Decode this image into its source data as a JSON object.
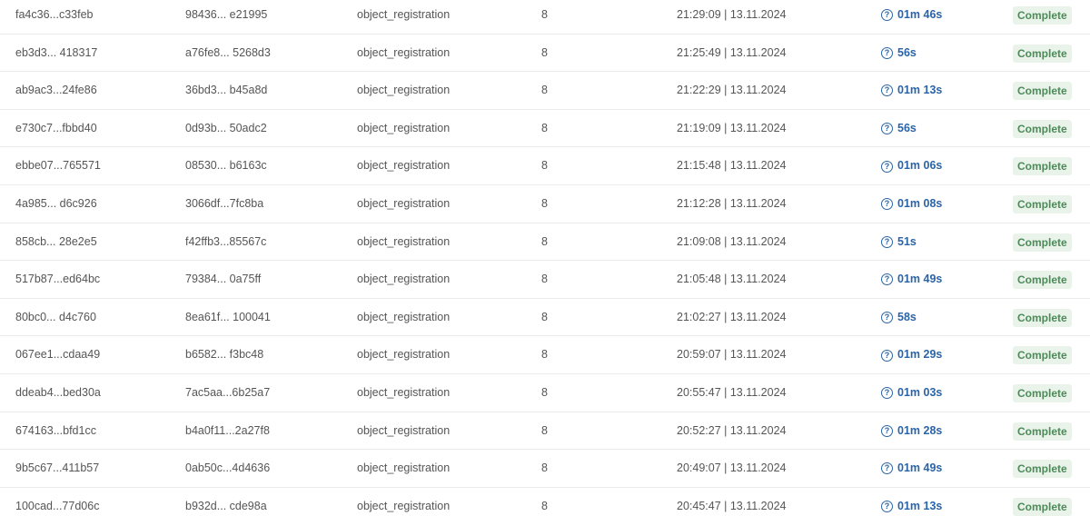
{
  "rows": [
    {
      "run_id": "fa4c36...c33feb",
      "hash": "98436... e21995",
      "task": "object_registration",
      "count": "8",
      "time": "21:29:09 | 13.11.2024",
      "duration": "01m 46s",
      "status": "Complete"
    },
    {
      "run_id": "eb3d3... 418317",
      "hash": "a76fe8... 5268d3",
      "task": "object_registration",
      "count": "8",
      "time": "21:25:49 | 13.11.2024",
      "duration": "56s",
      "status": "Complete"
    },
    {
      "run_id": "ab9ac3...24fe86",
      "hash": "36bd3... b45a8d",
      "task": "object_registration",
      "count": "8",
      "time": "21:22:29 | 13.11.2024",
      "duration": "01m 13s",
      "status": "Complete"
    },
    {
      "run_id": "e730c7...fbbd40",
      "hash": "0d93b... 50adc2",
      "task": "object_registration",
      "count": "8",
      "time": "21:19:09 | 13.11.2024",
      "duration": "56s",
      "status": "Complete"
    },
    {
      "run_id": "ebbe07...765571",
      "hash": "08530... b6163c",
      "task": "object_registration",
      "count": "8",
      "time": "21:15:48 | 13.11.2024",
      "duration": "01m 06s",
      "status": "Complete"
    },
    {
      "run_id": "4a985... d6c926",
      "hash": "3066df...7fc8ba",
      "task": "object_registration",
      "count": "8",
      "time": "21:12:28 | 13.11.2024",
      "duration": "01m 08s",
      "status": "Complete"
    },
    {
      "run_id": "858cb... 28e2e5",
      "hash": "f42ffb3...85567c",
      "task": "object_registration",
      "count": "8",
      "time": "21:09:08 | 13.11.2024",
      "duration": "51s",
      "status": "Complete"
    },
    {
      "run_id": "517b87...ed64bc",
      "hash": "79384... 0a75ff",
      "task": "object_registration",
      "count": "8",
      "time": "21:05:48 | 13.11.2024",
      "duration": "01m 49s",
      "status": "Complete"
    },
    {
      "run_id": "80bc0... d4c760",
      "hash": "8ea61f... 100041",
      "task": "object_registration",
      "count": "8",
      "time": "21:02:27 | 13.11.2024",
      "duration": "58s",
      "status": "Complete"
    },
    {
      "run_id": "067ee1...cdaa49",
      "hash": "b6582... f3bc48",
      "task": "object_registration",
      "count": "8",
      "time": "20:59:07 | 13.11.2024",
      "duration": "01m 29s",
      "status": "Complete"
    },
    {
      "run_id": "ddeab4...bed30a",
      "hash": "7ac5aa...6b25a7",
      "task": "object_registration",
      "count": "8",
      "time": "20:55:47 | 13.11.2024",
      "duration": "01m 03s",
      "status": "Complete"
    },
    {
      "run_id": "674163...bfd1cc",
      "hash": "b4a0f11...2a27f8",
      "task": "object_registration",
      "count": "8",
      "time": "20:52:27 | 13.11.2024",
      "duration": "01m 28s",
      "status": "Complete"
    },
    {
      "run_id": "9b5c67...411b57",
      "hash": "0ab50c...4d4636",
      "task": "object_registration",
      "count": "8",
      "time": "20:49:07 | 13.11.2024",
      "duration": "01m 49s",
      "status": "Complete"
    },
    {
      "run_id": "100cad...77d06c",
      "hash": "b932d... cde98a",
      "task": "object_registration",
      "count": "8",
      "time": "20:45:47 | 13.11.2024",
      "duration": "01m 13s",
      "status": "Complete"
    }
  ],
  "icons": {
    "duration": "question-circle-icon"
  },
  "colors": {
    "duration": "#2a64a8",
    "status_bg": "#e9f3ea",
    "status_text": "#4c8b58"
  }
}
